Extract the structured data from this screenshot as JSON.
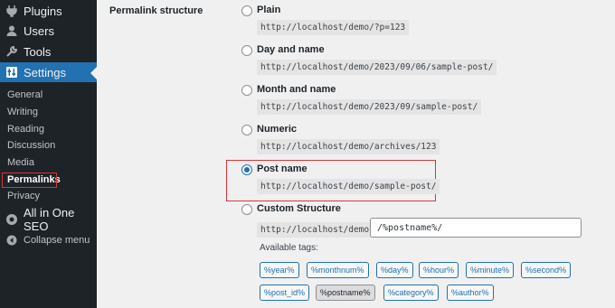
{
  "sidebar": {
    "menu": [
      {
        "label": "Plugins",
        "icon": "plug-icon"
      },
      {
        "label": "Users",
        "icon": "user-icon"
      },
      {
        "label": "Tools",
        "icon": "wrench-icon"
      },
      {
        "label": "Settings",
        "icon": "settings-icon"
      },
      {
        "label": "All in One SEO",
        "icon": "aioseo-icon"
      },
      {
        "label": "Collapse menu",
        "icon": "collapse-icon"
      }
    ],
    "submenu": [
      "General",
      "Writing",
      "Reading",
      "Discussion",
      "Media",
      "Permalinks",
      "Privacy"
    ]
  },
  "main": {
    "section_label": "Permalink structure",
    "options": [
      {
        "label": "Plain",
        "example": "http://localhost/demo/?p=123",
        "checked": false
      },
      {
        "label": "Day and name",
        "example": "http://localhost/demo/2023/09/06/sample-post/",
        "checked": false
      },
      {
        "label": "Month and name",
        "example": "http://localhost/demo/2023/09/sample-post/",
        "checked": false
      },
      {
        "label": "Numeric",
        "example": "http://localhost/demo/archives/123",
        "checked": false
      },
      {
        "label": "Post name",
        "example": "http://localhost/demo/sample-post/",
        "checked": true
      },
      {
        "label": "Custom Structure",
        "example": "http://localhost/demo",
        "checked": false
      }
    ],
    "custom_value": "/%postname%/",
    "available_tags_label": "Available tags:",
    "tags": [
      "%year%",
      "%monthnum%",
      "%day%",
      "%hour%",
      "%minute%",
      "%second%",
      "%post_id%",
      "%postname%",
      "%category%",
      "%author%"
    ],
    "active_tag": "%postname%"
  },
  "colors": {
    "sidebar_bg": "#1d2327",
    "accent": "#2271b1",
    "highlight_border": "#d63638"
  }
}
